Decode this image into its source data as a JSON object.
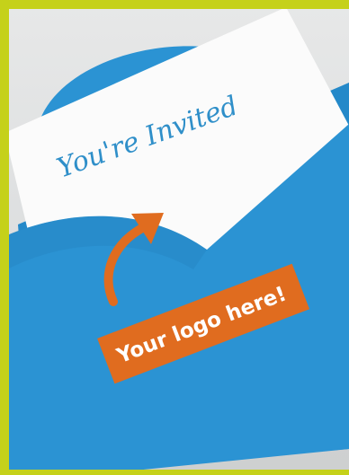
{
  "card": {
    "heading": "You're Invited"
  },
  "badge": {
    "label": "Your logo here!",
    "color": "#e06c1f"
  },
  "colors": {
    "frame": "#c5d11a",
    "envelope": "#2b93d3",
    "envelope_dark": "#227fbb",
    "card": "#fbfbfb",
    "script_text": "#2f8fc9",
    "arrow": "#e06c1f"
  },
  "icons": {
    "pointer": "curved-arrow-icon"
  }
}
